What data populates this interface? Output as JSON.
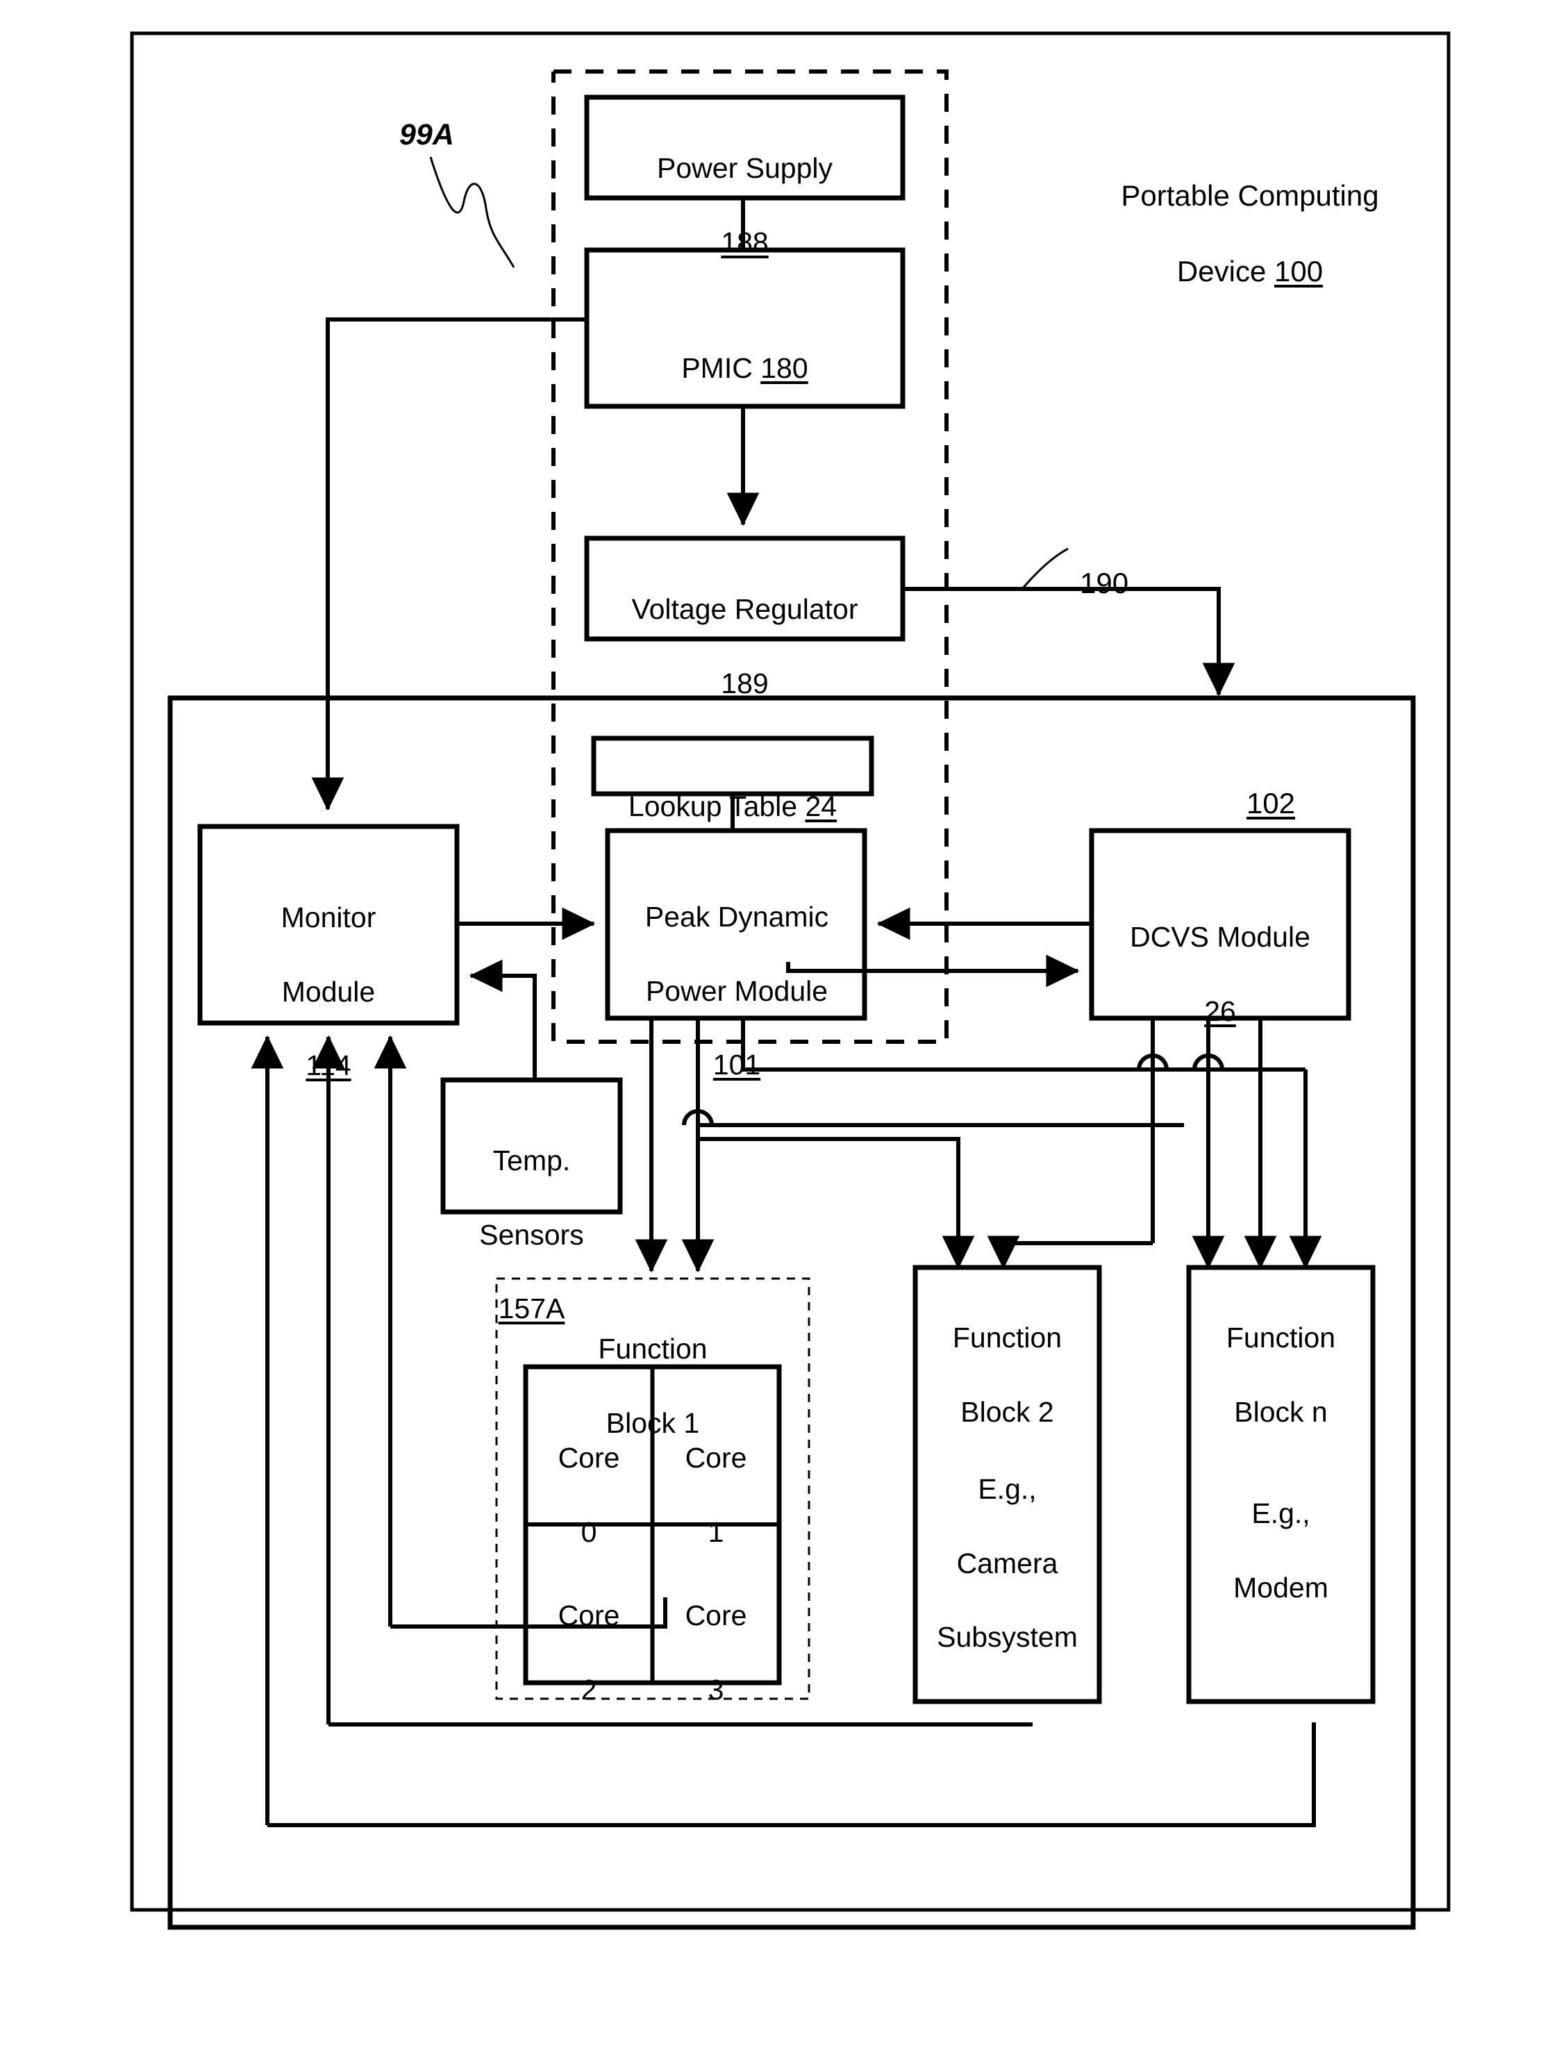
{
  "figure": {
    "outer_label_line1": "Portable Computing",
    "outer_label_line2": "Device ",
    "outer_label_ref": "100",
    "callout_99a": "99A",
    "callout_190": "190",
    "soc_ref": "102"
  },
  "blocks": {
    "power_supply": {
      "title": "Power Supply",
      "ref": "188"
    },
    "pmic": {
      "title": "PMIC ",
      "ref": "180"
    },
    "voltage_regulator": {
      "title": "Voltage Regulator",
      "ref": "189"
    },
    "lookup_table": {
      "title": "Lookup Table ",
      "ref": "24"
    },
    "peak_dynamic_power_module": {
      "line1": "Peak Dynamic",
      "line2": "Power Module",
      "ref": "101"
    },
    "dcvs_module": {
      "title": "DCVS Module",
      "ref": "26"
    },
    "monitor_module": {
      "line1": "Monitor",
      "line2": "Module",
      "ref": "114"
    },
    "temp_sensors": {
      "line1": "Temp.",
      "line2": "Sensors",
      "ref": "157A"
    },
    "function_block_1": {
      "line1": "Function",
      "line2": "Block 1"
    },
    "function_block_2": {
      "line1": "Function",
      "line2": "Block 2",
      "detail1": "E.g.,",
      "detail2": "Camera",
      "detail3": "Subsystem"
    },
    "function_block_n": {
      "line1": "Function",
      "line2": "Block n",
      "detail1": "E.g.,",
      "detail2": "Modem"
    },
    "cores": [
      {
        "line1": "Core",
        "line2": "0"
      },
      {
        "line1": "Core",
        "line2": "1"
      },
      {
        "line1": "Core",
        "line2": "2"
      },
      {
        "line1": "Core",
        "line2": "3"
      }
    ]
  },
  "colors": {
    "ink": "#000000",
    "paper": "#ffffff"
  }
}
